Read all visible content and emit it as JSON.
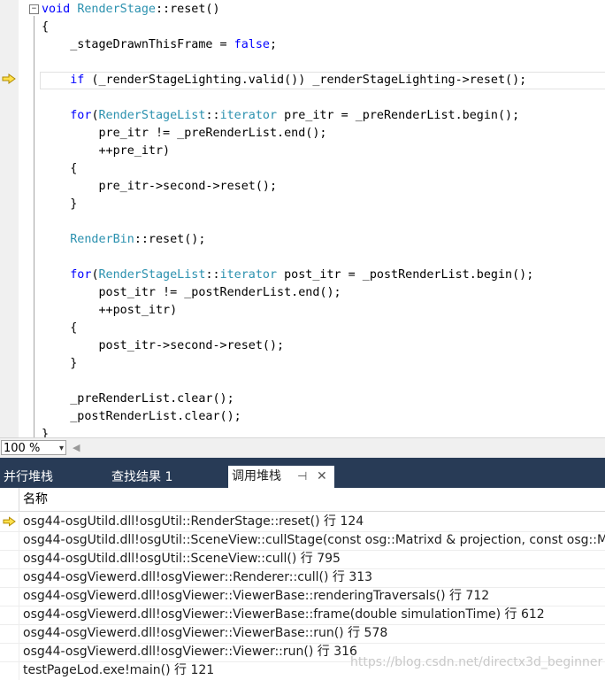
{
  "code": {
    "lines": [
      [
        {
          "t": "void ",
          "c": "kw"
        },
        {
          "t": "RenderStage",
          "c": "ty"
        },
        {
          "t": "::reset()",
          "c": ""
        }
      ],
      [
        {
          "t": "{",
          "c": ""
        }
      ],
      [
        {
          "t": "    _stageDrawnThisFrame = ",
          "c": ""
        },
        {
          "t": "false",
          "c": "kw"
        },
        {
          "t": ";",
          "c": ""
        }
      ],
      [],
      [
        {
          "t": "    ",
          "c": ""
        },
        {
          "t": "if",
          "c": "kw"
        },
        {
          "t": " (_renderStageLighting.valid()) _renderStageLighting->reset();",
          "c": ""
        }
      ],
      [],
      [
        {
          "t": "    ",
          "c": ""
        },
        {
          "t": "for",
          "c": "kw"
        },
        {
          "t": "(",
          "c": ""
        },
        {
          "t": "RenderStageList",
          "c": "ty"
        },
        {
          "t": "::",
          "c": ""
        },
        {
          "t": "iterator",
          "c": "ty"
        },
        {
          "t": " pre_itr = _preRenderList.begin();",
          "c": ""
        }
      ],
      [
        {
          "t": "        pre_itr != _preRenderList.end();",
          "c": ""
        }
      ],
      [
        {
          "t": "        ++pre_itr)",
          "c": ""
        }
      ],
      [
        {
          "t": "    {",
          "c": ""
        }
      ],
      [
        {
          "t": "        pre_itr->second->reset();",
          "c": ""
        }
      ],
      [
        {
          "t": "    }",
          "c": ""
        }
      ],
      [],
      [
        {
          "t": "    ",
          "c": ""
        },
        {
          "t": "RenderBin",
          "c": "ty"
        },
        {
          "t": "::reset();",
          "c": ""
        }
      ],
      [],
      [
        {
          "t": "    ",
          "c": ""
        },
        {
          "t": "for",
          "c": "kw"
        },
        {
          "t": "(",
          "c": ""
        },
        {
          "t": "RenderStageList",
          "c": "ty"
        },
        {
          "t": "::",
          "c": ""
        },
        {
          "t": "iterator",
          "c": "ty"
        },
        {
          "t": " post_itr = _postRenderList.begin();",
          "c": ""
        }
      ],
      [
        {
          "t": "        post_itr != _postRenderList.end();",
          "c": ""
        }
      ],
      [
        {
          "t": "        ++post_itr)",
          "c": ""
        }
      ],
      [
        {
          "t": "    {",
          "c": ""
        }
      ],
      [
        {
          "t": "        post_itr->second->reset();",
          "c": ""
        }
      ],
      [
        {
          "t": "    }",
          "c": ""
        }
      ],
      [],
      [
        {
          "t": "    _preRenderList.clear();",
          "c": ""
        }
      ],
      [
        {
          "t": "    _postRenderList.clear();",
          "c": ""
        }
      ],
      [
        {
          "t": "}",
          "c": ""
        }
      ]
    ],
    "fold_symbol": "−",
    "current_line_index": 4
  },
  "statusbar": {
    "zoom": "100 %",
    "zoom_dropdown_icon": "▾",
    "scroll_left_icon": "◀"
  },
  "tabs": [
    {
      "label": "并行堆栈",
      "active": false
    },
    {
      "label": "查找结果 1",
      "active": false
    },
    {
      "label": "调用堆栈",
      "active": true
    }
  ],
  "tab_icons": {
    "pin": "⊣",
    "close": "✕"
  },
  "callstack": {
    "column_name": "名称",
    "rows": [
      {
        "text": "osg44-osgUtild.dll!osgUtil::RenderStage::reset() 行 124",
        "current": true
      },
      {
        "text": "osg44-osgUtild.dll!osgUtil::SceneView::cullStage(const osg::Matrixd & projection, const osg::Matrixd",
        "current": false
      },
      {
        "text": "osg44-osgUtild.dll!osgUtil::SceneView::cull() 行 795",
        "current": false
      },
      {
        "text": "osg44-osgViewerd.dll!osgViewer::Renderer::cull() 行 313",
        "current": false
      },
      {
        "text": "osg44-osgViewerd.dll!osgViewer::ViewerBase::renderingTraversals() 行 712",
        "current": false
      },
      {
        "text": "osg44-osgViewerd.dll!osgViewer::ViewerBase::frame(double simulationTime) 行 612",
        "current": false
      },
      {
        "text": "osg44-osgViewerd.dll!osgViewer::ViewerBase::run() 行 578",
        "current": false
      },
      {
        "text": "osg44-osgViewerd.dll!osgViewer::Viewer::run() 行 316",
        "current": false
      },
      {
        "text": "testPageLod.exe!main() 行 121",
        "current": false
      }
    ]
  },
  "watermark": "https://blog.csdn.net/directx3d_beginner",
  "colors": {
    "arrow_fill": "#ffe14d",
    "arrow_stroke": "#b08a00"
  }
}
